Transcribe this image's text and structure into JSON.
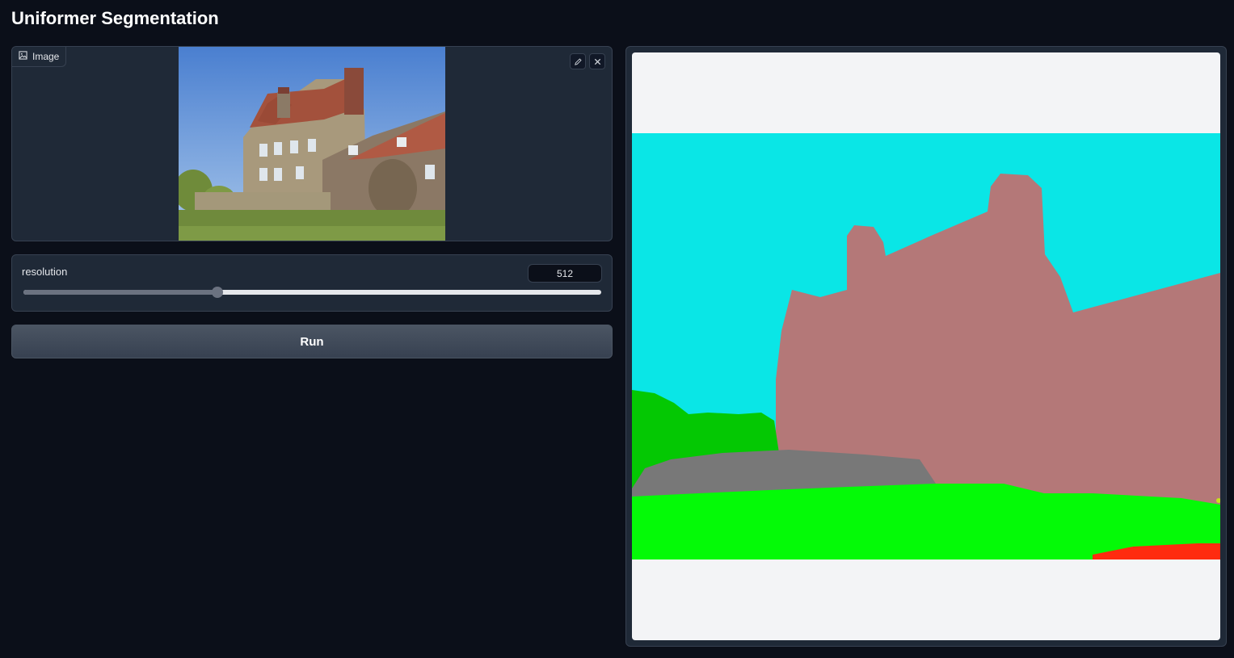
{
  "app": {
    "title": "Uniformer Segmentation"
  },
  "image_input": {
    "label": "Image",
    "icon": "image-icon",
    "edit_icon": "pencil-icon",
    "close_icon": "close-icon"
  },
  "resolution": {
    "label": "resolution",
    "value": "512",
    "fraction": 0.336
  },
  "run": {
    "label": "Run"
  },
  "output": {
    "type": "segmentation-map"
  },
  "colors": {
    "background": "#0b0f19",
    "panel": "#1f2937",
    "border": "#374151",
    "seg_sky": "#0ae6e6",
    "seg_building": "#b47878",
    "seg_tree": "#04c803",
    "seg_wall": "#787878",
    "seg_grass": "#04fa07",
    "seg_road": "#ff2b0f"
  }
}
